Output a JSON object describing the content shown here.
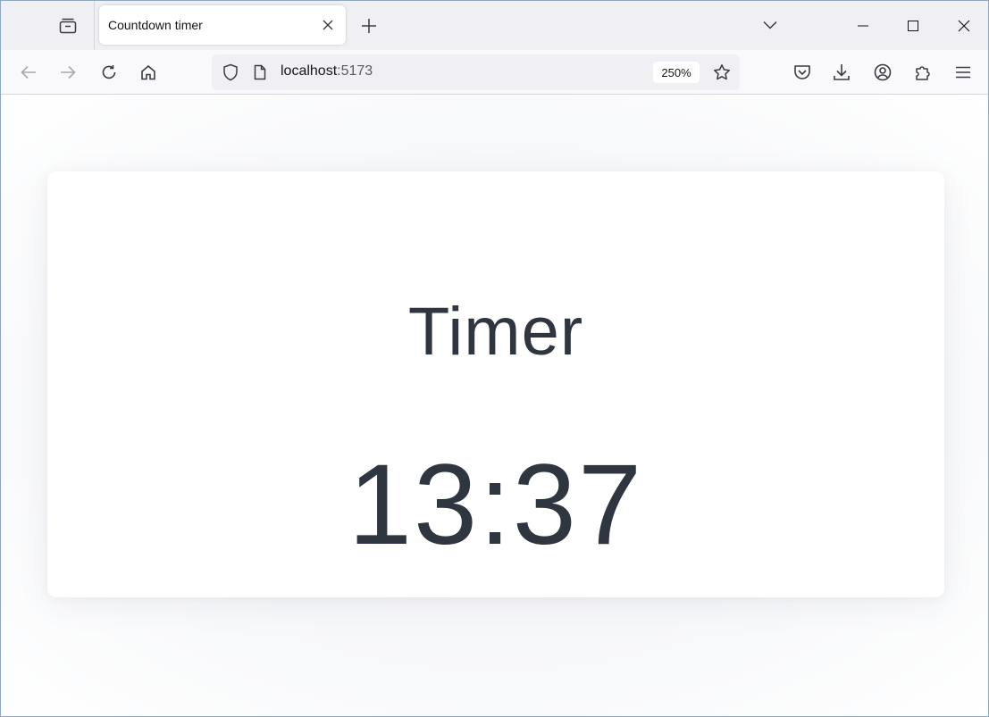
{
  "browser": {
    "tab": {
      "title": "Countdown timer"
    },
    "urlbar": {
      "host": "localhost",
      "port": ":5173",
      "zoom": "250%"
    }
  },
  "page": {
    "title": "Timer",
    "time": "13:37"
  }
}
